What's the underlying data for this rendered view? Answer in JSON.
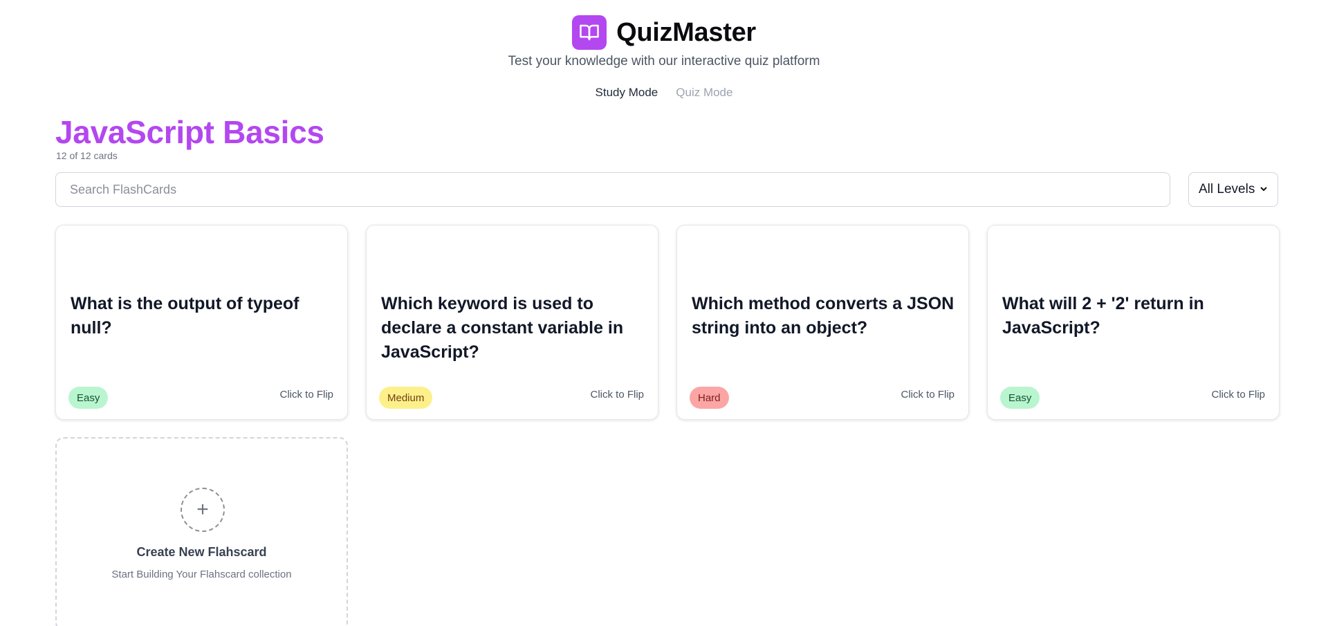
{
  "app": {
    "title": "QuizMaster",
    "subtitle": "Test your knowledge with our interactive quiz platform",
    "logo_icon": "open-book-icon",
    "accent_color": "#b347f0"
  },
  "modes": {
    "study": "Study Mode",
    "quiz": "Quiz Mode",
    "active": "study"
  },
  "deck": {
    "title": "JavaScript Basics",
    "count": "12 of 12 cards"
  },
  "search": {
    "placeholder": "Search FlashCards",
    "value": ""
  },
  "filter": {
    "selected": "All Levels"
  },
  "cards": [
    {
      "question": "What is the output of typeof null?",
      "level": "Easy",
      "flip_label": "Click to Flip"
    },
    {
      "question": "Which keyword is used to declare a constant variable in JavaScript?",
      "level": "Medium",
      "flip_label": "Click to Flip"
    },
    {
      "question": "Which method converts a JSON string into an object?",
      "level": "Hard",
      "flip_label": "Click to Flip"
    },
    {
      "question": "What will 2 + '2' return in JavaScript?",
      "level": "Easy",
      "flip_label": "Click to Flip"
    }
  ],
  "level_colors": {
    "Easy": "#b9f5cf",
    "Medium": "#fdf08a",
    "Hard": "#fca5a5"
  },
  "create": {
    "icon": "plus-icon",
    "symbol": "+",
    "title": "Create New Flahscard",
    "subtitle": "Start Building Your Flahscard collection"
  }
}
